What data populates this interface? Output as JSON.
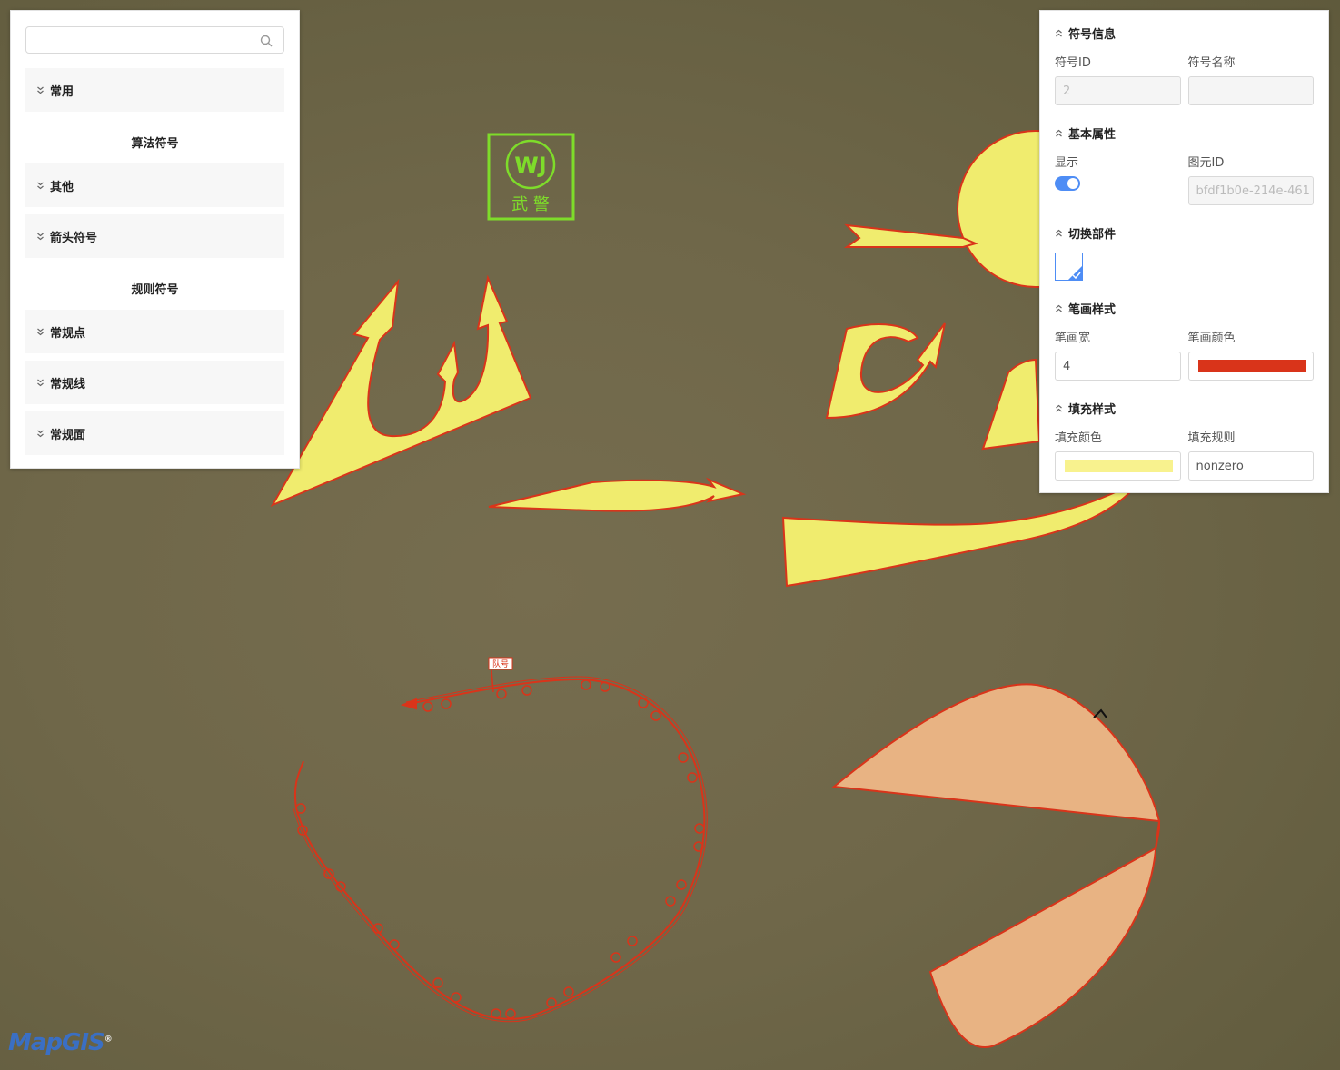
{
  "left_panel": {
    "search": {
      "placeholder": "",
      "value": ""
    },
    "common_label": "常用",
    "algo_group_title": "算法符号",
    "algo_items": [
      "其他",
      "箭头符号"
    ],
    "rule_group_title": "规则符号",
    "rule_items": [
      "常规点",
      "常规线",
      "常规面"
    ]
  },
  "right_panel": {
    "symbol_info": {
      "title": "符号信息",
      "id_label": "符号ID",
      "id_value": "2",
      "name_label": "符号名称",
      "name_value": ""
    },
    "basic_props": {
      "title": "基本属性",
      "visible_label": "显示",
      "visible": true,
      "element_id_label": "图元ID",
      "element_id_value": "bfdf1b0e-214e-461"
    },
    "switch_part": {
      "title": "切换部件"
    },
    "stroke_style": {
      "title": "笔画样式",
      "width_label": "笔画宽",
      "width_value": "4",
      "color_label": "笔画颜色",
      "color_value": "#d9341a"
    },
    "fill_style": {
      "title": "填充样式",
      "color_label": "填充颜色",
      "color_value": "#f8f28e",
      "rule_label": "填充规则",
      "rule_value": "nonzero"
    }
  },
  "map": {
    "wj_symbol": {
      "line1": "WJ",
      "line2": "武 警"
    },
    "flag_label": "队号",
    "colors": {
      "stroke": "#d9341a",
      "yellow_fill": "#f0ec6e",
      "peach_fill": "#e8b383",
      "green": "#7edc2a"
    }
  },
  "logo": {
    "text": "MapGIS"
  }
}
